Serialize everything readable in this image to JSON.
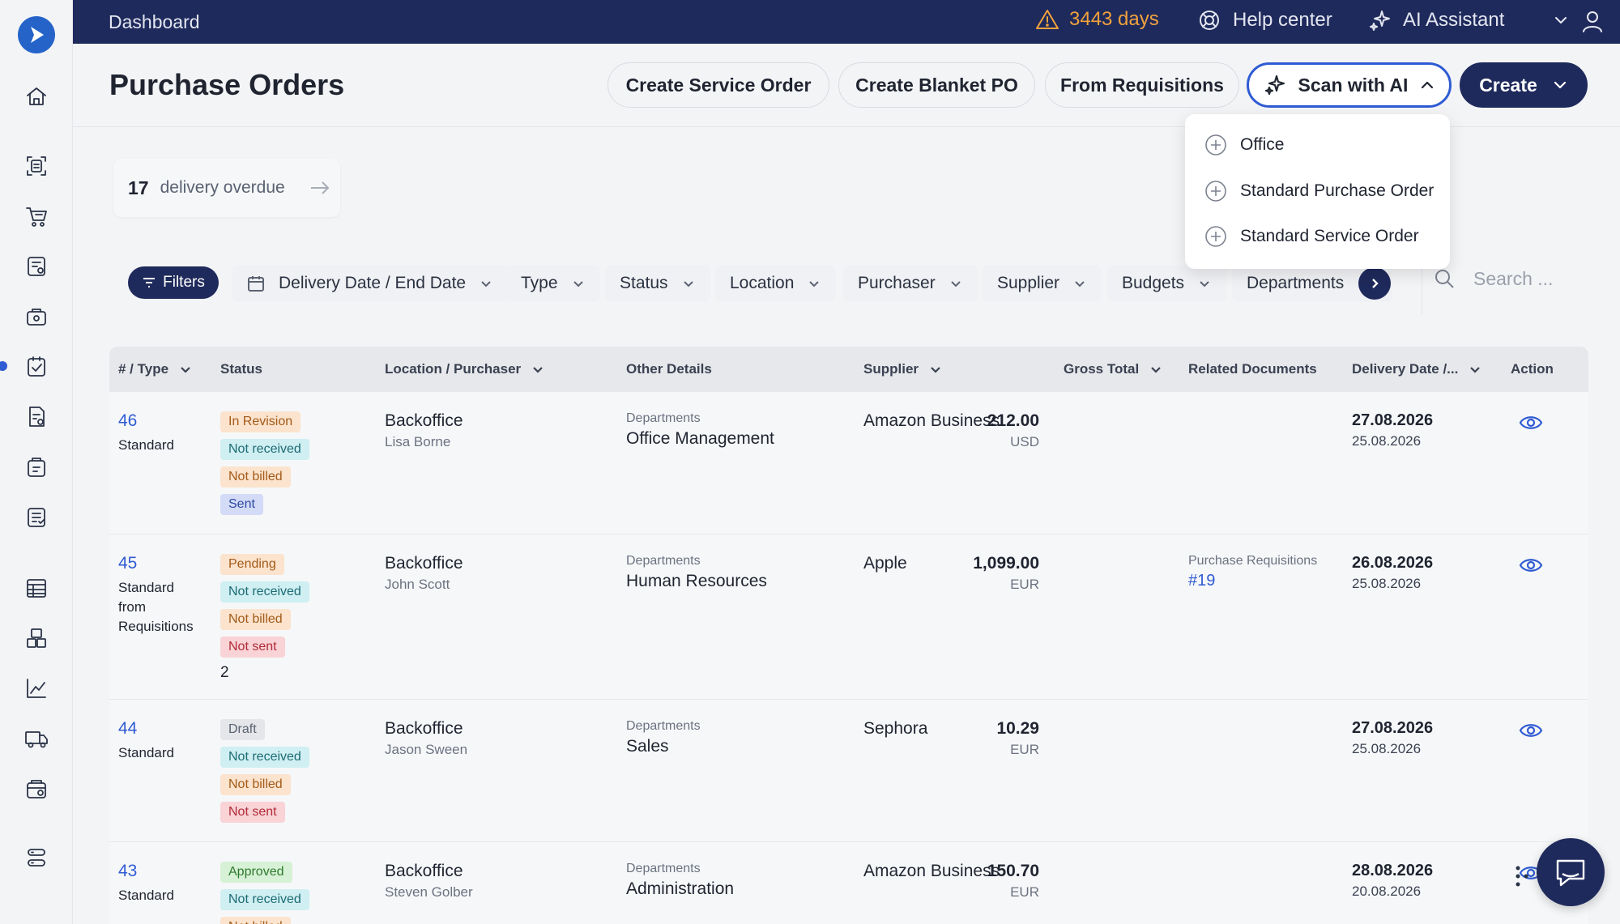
{
  "topbar": {
    "breadcrumb": "Dashboard",
    "trial": "3443 days",
    "help": "Help center",
    "ai": "AI Assistant"
  },
  "header": {
    "title": "Purchase Orders",
    "buttons": {
      "service_order": "Create Service Order",
      "blanket_po": "Create Blanket PO",
      "from_requisitions": "From Requisitions",
      "scan_ai": "Scan with AI",
      "create": "Create"
    }
  },
  "dropdown": {
    "items": [
      "Office",
      "Standard Purchase Order",
      "Standard Service Order"
    ]
  },
  "overdue": {
    "count": "17",
    "label": "delivery overdue"
  },
  "filters": {
    "filters_label": "Filters",
    "chips": [
      "Delivery Date / End Date",
      "Type",
      "Status",
      "Location",
      "Purchaser",
      "Supplier",
      "Budgets",
      "Departments"
    ],
    "search_placeholder": "Search ..."
  },
  "table": {
    "headers": {
      "num_type": "# / Type",
      "status": "Status",
      "location": "Location / Purchaser",
      "other": "Other Details",
      "supplier": "Supplier",
      "gross": "Gross Total",
      "related": "Related Documents",
      "delivery": "Delivery Date /...",
      "action": "Action"
    },
    "rows": [
      {
        "num": "46",
        "type": "Standard",
        "badges": [
          "In Revision",
          "Not received",
          "Not billed",
          "Sent"
        ],
        "location": "Backoffice",
        "purchaser": "Lisa Borne",
        "dept_label": "Departments",
        "dept": "Office Management",
        "supplier": "Amazon Business",
        "amount": "212.00",
        "currency": "USD",
        "related_label": "",
        "related_link": "",
        "date1": "27.08.2026",
        "date2": "25.08.2026"
      },
      {
        "num": "45",
        "type": "Standard from Requisitions",
        "badges": [
          "Pending",
          "Not received",
          "Not billed",
          "Not sent"
        ],
        "extra": "2",
        "location": "Backoffice",
        "purchaser": "John Scott",
        "dept_label": "Departments",
        "dept": "Human Resources",
        "supplier": "Apple",
        "amount": "1,099.00",
        "currency": "EUR",
        "related_label": "Purchase Requisitions",
        "related_link": "#19",
        "date1": "26.08.2026",
        "date2": "25.08.2026"
      },
      {
        "num": "44",
        "type": "Standard",
        "badges": [
          "Draft",
          "Not received",
          "Not billed",
          "Not sent"
        ],
        "location": "Backoffice",
        "purchaser": "Jason Sween",
        "dept_label": "Departments",
        "dept": "Sales",
        "supplier": "Sephora",
        "amount": "10.29",
        "currency": "EUR",
        "related_label": "",
        "related_link": "",
        "date1": "27.08.2026",
        "date2": "25.08.2026"
      },
      {
        "num": "43",
        "type": "Standard",
        "badges": [
          "Approved",
          "Not received",
          "Not billed"
        ],
        "location": "Backoffice",
        "purchaser": "Steven Golber",
        "dept_label": "Departments",
        "dept": "Administration",
        "supplier": "Amazon Business",
        "amount": "150.70",
        "currency": "EUR",
        "related_label": "",
        "related_link": "",
        "date1": "28.08.2026",
        "date2": "20.08.2026"
      }
    ]
  },
  "colors": {
    "navy": "#1f2a5c",
    "accent": "#2f5bd3",
    "warning": "#f0a23c"
  }
}
